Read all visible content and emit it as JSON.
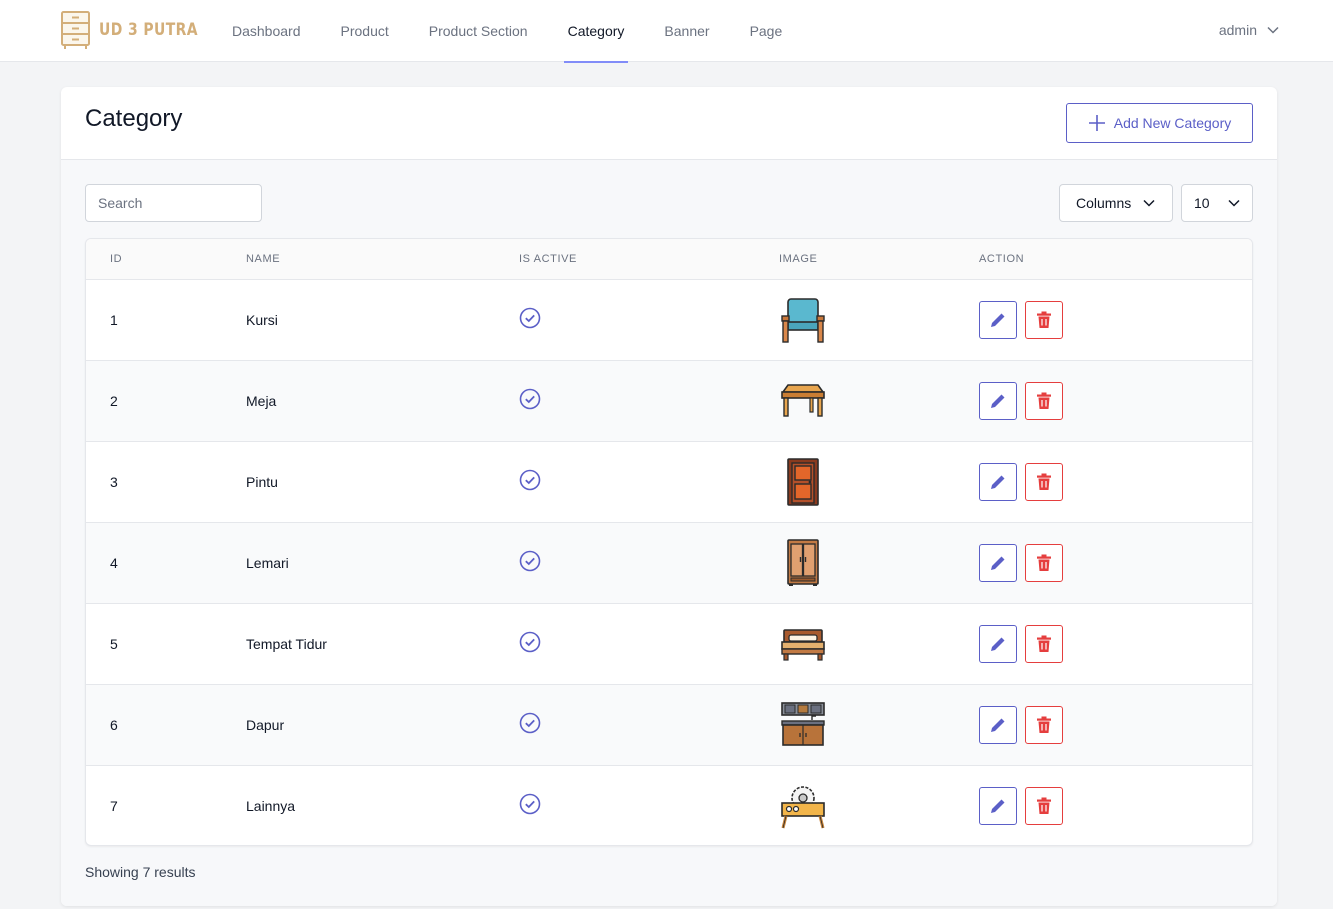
{
  "brand": {
    "name": "UD 3 PUTRA",
    "color": "#d3ae79"
  },
  "nav": {
    "items": [
      {
        "label": "Dashboard"
      },
      {
        "label": "Product"
      },
      {
        "label": "Product Section"
      },
      {
        "label": "Category",
        "active": true
      },
      {
        "label": "Banner"
      },
      {
        "label": "Page"
      }
    ],
    "user": "admin"
  },
  "page": {
    "title": "Category",
    "add_label": "Add New Category"
  },
  "toolbar": {
    "search_placeholder": "Search",
    "columns_label": "Columns",
    "per_page": "10"
  },
  "table": {
    "headers": {
      "id": "ID",
      "name": "NAME",
      "active": "IS ACTIVE",
      "image": "IMAGE",
      "action": "ACTION"
    },
    "rows": [
      {
        "id": "1",
        "name": "Kursi",
        "active": true,
        "image_icon": "armchair-icon"
      },
      {
        "id": "2",
        "name": "Meja",
        "active": true,
        "image_icon": "table-icon"
      },
      {
        "id": "3",
        "name": "Pintu",
        "active": true,
        "image_icon": "door-icon"
      },
      {
        "id": "4",
        "name": "Lemari",
        "active": true,
        "image_icon": "wardrobe-icon"
      },
      {
        "id": "5",
        "name": "Tempat Tidur",
        "active": true,
        "image_icon": "bed-icon"
      },
      {
        "id": "6",
        "name": "Dapur",
        "active": true,
        "image_icon": "kitchen-icon"
      },
      {
        "id": "7",
        "name": "Lainnya",
        "active": true,
        "image_icon": "table-saw-icon"
      }
    ]
  },
  "footer": {
    "summary": "Showing 7 results"
  },
  "colors": {
    "accent": "#5b5fc7",
    "danger": "#e53e3e",
    "nav_underline": "#818cf8"
  }
}
